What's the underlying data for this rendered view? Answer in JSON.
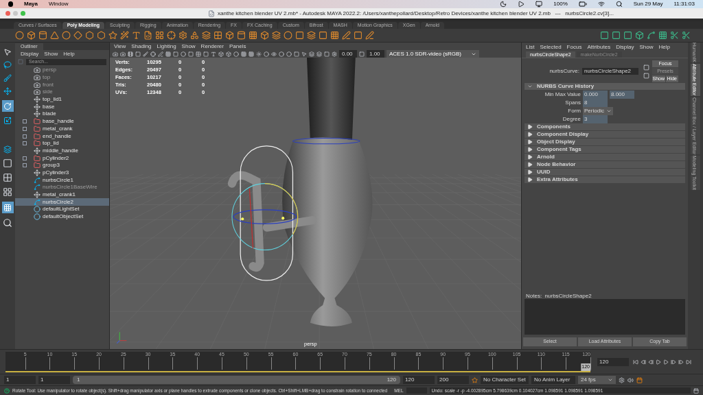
{
  "mac_menu": {
    "items": [
      "Maya",
      "Window"
    ],
    "battery": "100%",
    "date": "Sun 29 May",
    "time": "11:31:03"
  },
  "window": {
    "title": "xanthe kitchen blender UV 2.mb* - Autodesk MAYA 2022.2: /Users/xanthepollard/Desktop/Retro Devices/xanthe kitchen blender UV 2.mb   ---   nurbsCircle2.cv[3]..."
  },
  "shelf_tabs": [
    {
      "label": "Curves / Surfaces",
      "selected": false
    },
    {
      "label": "Poly Modeling",
      "selected": true
    },
    {
      "label": "Sculpting",
      "selected": false
    },
    {
      "label": "Rigging",
      "selected": false
    },
    {
      "label": "Animation",
      "selected": false
    },
    {
      "label": "Rendering",
      "selected": false
    },
    {
      "label": "FX",
      "selected": false
    },
    {
      "label": "FX Caching",
      "selected": false
    },
    {
      "label": "Custom",
      "selected": false
    },
    {
      "label": "Bifrost",
      "selected": false
    },
    {
      "label": "MASH",
      "selected": false
    },
    {
      "label": "Motion Graphics",
      "selected": false
    },
    {
      "label": "XGen",
      "selected": false
    },
    {
      "label": "Arnold",
      "selected": false
    }
  ],
  "outliner": {
    "title": "Outliner",
    "menu": [
      "Display",
      "Show",
      "Help"
    ],
    "search": {
      "placeholder": "Search..."
    },
    "items": [
      {
        "label": "persp",
        "kind": "camera",
        "expandable": false,
        "dimmed": true,
        "selected": false
      },
      {
        "label": "top",
        "kind": "camera",
        "expandable": false,
        "dimmed": true,
        "selected": false
      },
      {
        "label": "front",
        "kind": "camera",
        "expandable": false,
        "dimmed": true,
        "selected": false
      },
      {
        "label": "side",
        "kind": "camera",
        "expandable": false,
        "dimmed": true,
        "selected": false
      },
      {
        "label": "top_lid1",
        "kind": "transform",
        "expandable": false,
        "dimmed": false,
        "selected": false
      },
      {
        "label": "base",
        "kind": "transform",
        "expandable": false,
        "dimmed": false,
        "selected": false
      },
      {
        "label": "blade",
        "kind": "transform",
        "expandable": false,
        "dimmed": false,
        "selected": false
      },
      {
        "label": "base_handle",
        "kind": "group",
        "expandable": true,
        "dimmed": false,
        "selected": false
      },
      {
        "label": "metal_crank",
        "kind": "group",
        "expandable": true,
        "dimmed": false,
        "selected": false
      },
      {
        "label": "end_handle",
        "kind": "group",
        "expandable": true,
        "dimmed": false,
        "selected": false
      },
      {
        "label": "top_lid",
        "kind": "group",
        "expandable": true,
        "dimmed": false,
        "selected": false
      },
      {
        "label": "middle_handle",
        "kind": "transform",
        "expandable": false,
        "dimmed": false,
        "selected": false
      },
      {
        "label": "pCylinder2",
        "kind": "group",
        "expandable": true,
        "dimmed": false,
        "selected": false
      },
      {
        "label": "group3",
        "kind": "group",
        "expandable": true,
        "dimmed": false,
        "selected": false
      },
      {
        "label": "pCylinder3",
        "kind": "transform",
        "expandable": false,
        "dimmed": false,
        "selected": false
      },
      {
        "label": "nurbsCircle1",
        "kind": "curve",
        "expandable": false,
        "dimmed": false,
        "selected": false
      },
      {
        "label": "nurbsCircle1BaseWire",
        "kind": "curve",
        "expandable": false,
        "dimmed": true,
        "selected": false
      },
      {
        "label": "metal_crank1",
        "kind": "transform",
        "expandable": false,
        "dimmed": false,
        "selected": false
      },
      {
        "label": "nurbsCircle2",
        "kind": "curve",
        "expandable": false,
        "dimmed": false,
        "selected": true
      },
      {
        "label": "defaultLightSet",
        "kind": "set",
        "expandable": false,
        "dimmed": false,
        "selected": false
      },
      {
        "label": "defaultObjectSet",
        "kind": "set",
        "expandable": false,
        "dimmed": false,
        "selected": false
      }
    ]
  },
  "viewport": {
    "menu": [
      "View",
      "Shading",
      "Lighting",
      "Show",
      "Renderer",
      "Panels"
    ],
    "exposure": "0.00",
    "gamma": "1.00",
    "color_space": "ACES 1.0 SDR-video (sRGB)",
    "stats": [
      {
        "label": "Verts:",
        "values": [
          "10295",
          "0",
          "0"
        ]
      },
      {
        "label": "Edges:",
        "values": [
          "20497",
          "0",
          "0"
        ]
      },
      {
        "label": "Faces:",
        "values": [
          "10217",
          "0",
          "0"
        ]
      },
      {
        "label": "Tris:",
        "values": [
          "20480",
          "0",
          "0"
        ]
      },
      {
        "label": "UVs:",
        "values": [
          "12348",
          "0",
          "0"
        ]
      }
    ],
    "camera": "persp"
  },
  "attribute_editor": {
    "menu": [
      "List",
      "Selected",
      "Focus",
      "Attributes",
      "Display",
      "Show",
      "Help"
    ],
    "tabs": [
      {
        "label": "nurbsCircleShape2",
        "selected": true
      },
      {
        "label": "makeNurbCircle2",
        "selected": false
      }
    ],
    "node_label": "nurbsCurve:",
    "node_value": "nurbsCircleShape2",
    "buttons": [
      {
        "label": "Focus",
        "disabled": false
      },
      {
        "label": "Presets",
        "disabled": true
      },
      {
        "label": "Show",
        "disabled": false
      },
      {
        "label": "Hide",
        "disabled": false
      }
    ],
    "history": {
      "title": "NURBS Curve History",
      "expanded": true,
      "rows": [
        {
          "label": "Min Max Value",
          "kind": "fields",
          "values": [
            "0.000",
            "8.000"
          ]
        },
        {
          "label": "Spans",
          "kind": "fields",
          "values": [
            "8"
          ]
        },
        {
          "label": "Form",
          "kind": "dropdown",
          "values": [
            "Periodic"
          ]
        },
        {
          "label": "Degree",
          "kind": "fields",
          "values": [
            "3"
          ]
        }
      ]
    },
    "sections": [
      {
        "title": "Components",
        "expanded": false
      },
      {
        "title": "Component Display",
        "expanded": false
      },
      {
        "title": "Object Display",
        "expanded": false
      },
      {
        "title": "Component Tags",
        "expanded": false
      },
      {
        "title": "Arnold",
        "expanded": false
      },
      {
        "title": "Node Behavior",
        "expanded": false
      },
      {
        "title": "UUID",
        "expanded": false
      },
      {
        "title": "Extra Attributes",
        "expanded": false
      }
    ],
    "notes_label": "Notes:  nurbsCircleShape2",
    "bottom_buttons": [
      "Select",
      "Load Attributes",
      "Copy Tab"
    ],
    "side_tabs": [
      {
        "label": "HumanIK",
        "selected": false
      },
      {
        "label": "Attribute Editor",
        "selected": true
      },
      {
        "label": "Channel Box / Layer Editor",
        "selected": false
      },
      {
        "label": "Modeling Toolkit",
        "selected": false
      }
    ]
  },
  "timeline": {
    "level": 1,
    "ticks": [
      "5",
      "10",
      "15",
      "20",
      "25",
      "30",
      "35",
      "40",
      "45",
      "50",
      "55",
      "60",
      "65",
      "70",
      "75",
      "80",
      "85",
      "90",
      "95",
      "100",
      "105",
      "110",
      "115",
      "120"
    ],
    "current_frame": "120",
    "current_field": "120"
  },
  "range": {
    "level": 1,
    "start": "1",
    "range_start": "1",
    "slider_start": "1",
    "slider_end": "120",
    "range_end": "120",
    "end": "200",
    "character_set": "No Character Set",
    "anim_layer": "No Anim Layer",
    "fps": "24 fps"
  },
  "help_line": {
    "text": "Rotate Tool: Use manipulator to rotate object(s). Shift+drag manipulator axis or plane handles to extrude components or clone objects. Ctrl+Shift+LMB+drag to constrain rotation to connected",
    "mel_label": "MEL",
    "result": "Undo: scale -r -p -4.002895cm 5.798639cm 0.104027cm 1.098591 1.098591 1.098591"
  }
}
